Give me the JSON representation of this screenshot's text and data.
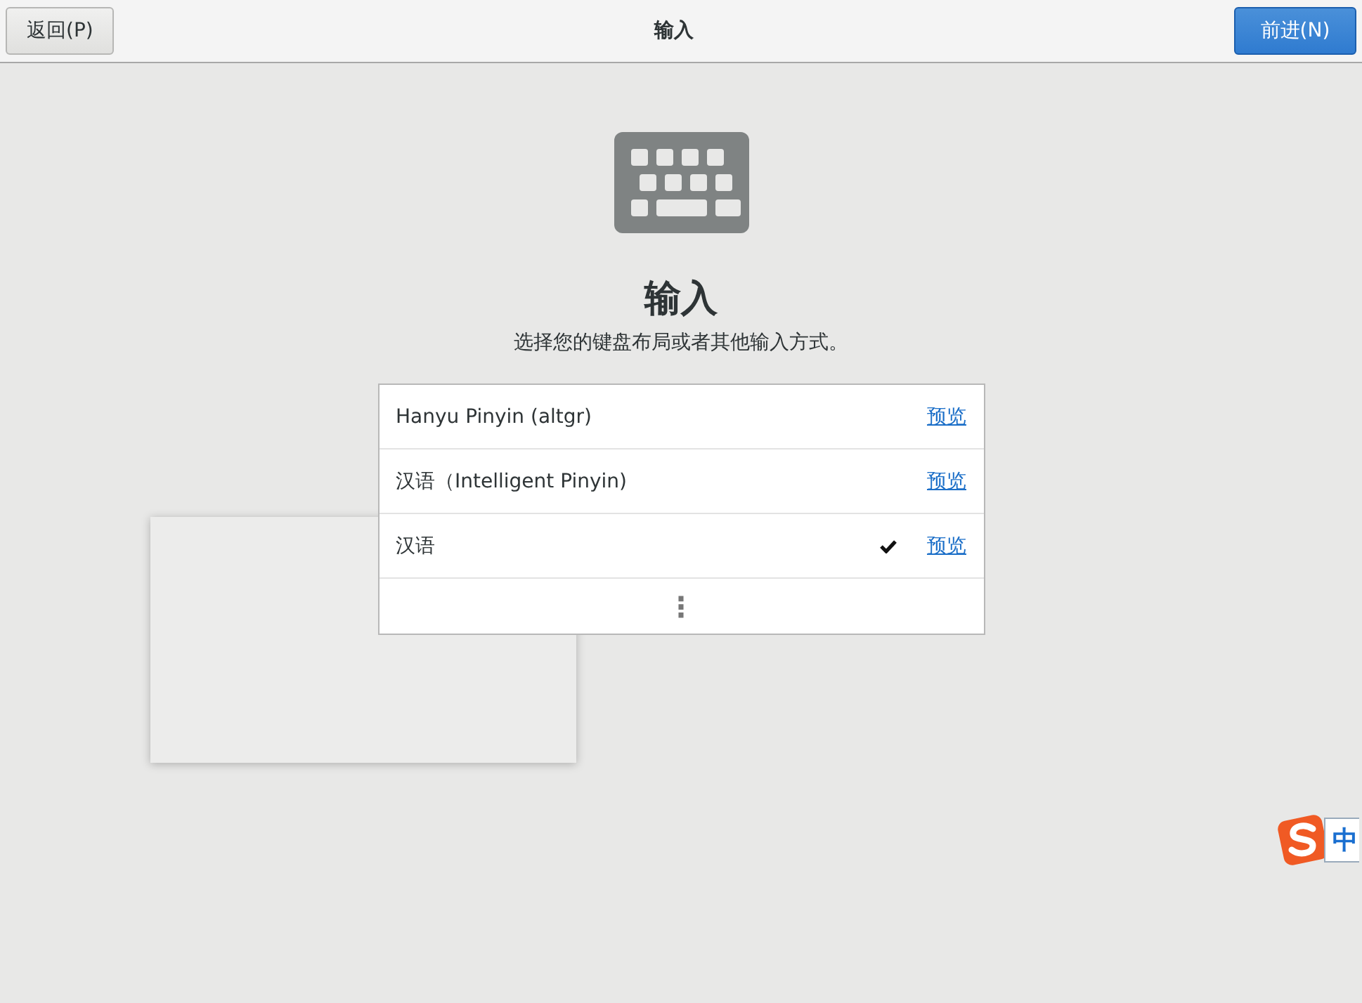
{
  "header": {
    "back_button": "返回(P)",
    "title": "输入",
    "next_button": "前进(N)"
  },
  "page": {
    "title": "输入",
    "subtitle": "选择您的键盘布局或者其他输入方式。"
  },
  "input_sources": [
    {
      "name": "Hanyu Pinyin (altgr)",
      "selected": false,
      "preview": "预览"
    },
    {
      "name": "汉语（Intelligent Pinyin)",
      "selected": false,
      "preview": "预览"
    },
    {
      "name": "汉语",
      "selected": true,
      "preview": "预览"
    }
  ],
  "more_button": "⋮",
  "popup": {
    "kind": "blank"
  },
  "ime_status": {
    "mode": "中"
  }
}
